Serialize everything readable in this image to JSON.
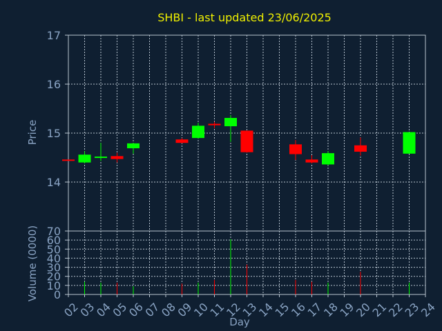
{
  "chart_data": [
    {
      "type": "candlestick",
      "title": "SHBI - last updated 23/06/2025",
      "ylabel": "Price",
      "ylim": [
        13,
        17
      ],
      "yticks": [
        14,
        15,
        16,
        17
      ],
      "grid": true,
      "candles": [
        {
          "day": "02",
          "open": 14.46,
          "close": 14.44,
          "high": 14.46,
          "low": 14.44
        },
        {
          "day": "03",
          "open": 14.4,
          "close": 14.56,
          "high": 14.63,
          "low": 14.38
        },
        {
          "day": "04",
          "open": 14.5,
          "close": 14.52,
          "high": 14.8,
          "low": 14.43
        },
        {
          "day": "05",
          "open": 14.53,
          "close": 14.47,
          "high": 14.6,
          "low": 14.4
        },
        {
          "day": "06",
          "open": 14.69,
          "close": 14.79,
          "high": 14.8,
          "low": 14.58
        },
        {
          "day": "09",
          "open": 14.87,
          "close": 14.8,
          "high": 14.9,
          "low": 14.79
        },
        {
          "day": "10",
          "open": 14.9,
          "close": 15.15,
          "high": 15.21,
          "low": 14.89
        },
        {
          "day": "11",
          "open": 15.19,
          "close": 15.16,
          "high": 15.23,
          "low": 15.1
        },
        {
          "day": "12",
          "open": 15.14,
          "close": 15.31,
          "high": 15.37,
          "low": 14.82
        },
        {
          "day": "13",
          "open": 15.05,
          "close": 14.61,
          "high": 15.05,
          "low": 14.6
        },
        {
          "day": "16",
          "open": 14.77,
          "close": 14.57,
          "high": 14.86,
          "low": 14.45
        },
        {
          "day": "17",
          "open": 14.46,
          "close": 14.4,
          "high": 14.55,
          "low": 14.38
        },
        {
          "day": "18",
          "open": 14.36,
          "close": 14.59,
          "high": 14.63,
          "low": 14.34
        },
        {
          "day": "20",
          "open": 14.75,
          "close": 14.62,
          "high": 14.91,
          "low": 14.54
        },
        {
          "day": "23",
          "open": 14.58,
          "close": 15.02,
          "high": 15.02,
          "low": 14.58
        }
      ]
    },
    {
      "type": "bar",
      "ylabel": "Volume (0000)",
      "xlabel": "Day",
      "ylim": [
        0,
        70
      ],
      "yticks": [
        0,
        10,
        20,
        30,
        40,
        50,
        60,
        70
      ],
      "grid": true,
      "categories": [
        "02",
        "03",
        "04",
        "05",
        "06",
        "07",
        "08",
        "09",
        "10",
        "11",
        "12",
        "13",
        "14",
        "15",
        "16",
        "17",
        "18",
        "19",
        "20",
        "21",
        "22",
        "23",
        "24"
      ],
      "volumes": [
        {
          "day": "03",
          "value": 14,
          "direction": "up"
        },
        {
          "day": "04",
          "value": 13,
          "direction": "up"
        },
        {
          "day": "05",
          "value": 13,
          "direction": "down"
        },
        {
          "day": "06",
          "value": 9,
          "direction": "up"
        },
        {
          "day": "09",
          "value": 12,
          "direction": "down"
        },
        {
          "day": "10",
          "value": 13,
          "direction": "up"
        },
        {
          "day": "11",
          "value": 16,
          "direction": "down"
        },
        {
          "day": "12",
          "value": 61,
          "direction": "up"
        },
        {
          "day": "13",
          "value": 33,
          "direction": "down"
        },
        {
          "day": "16",
          "value": 16,
          "direction": "down"
        },
        {
          "day": "17",
          "value": 14,
          "direction": "down"
        },
        {
          "day": "18",
          "value": 13,
          "direction": "up"
        },
        {
          "day": "20",
          "value": 25,
          "direction": "down"
        },
        {
          "day": "23",
          "value": 13,
          "direction": "up"
        }
      ]
    }
  ],
  "colors": {
    "background": "#0f1f31",
    "grid": "#b8c4d0",
    "axis_text": "#8aa4c4",
    "title": "#f0f000",
    "up": "#00ff00",
    "down": "#ff0000"
  }
}
